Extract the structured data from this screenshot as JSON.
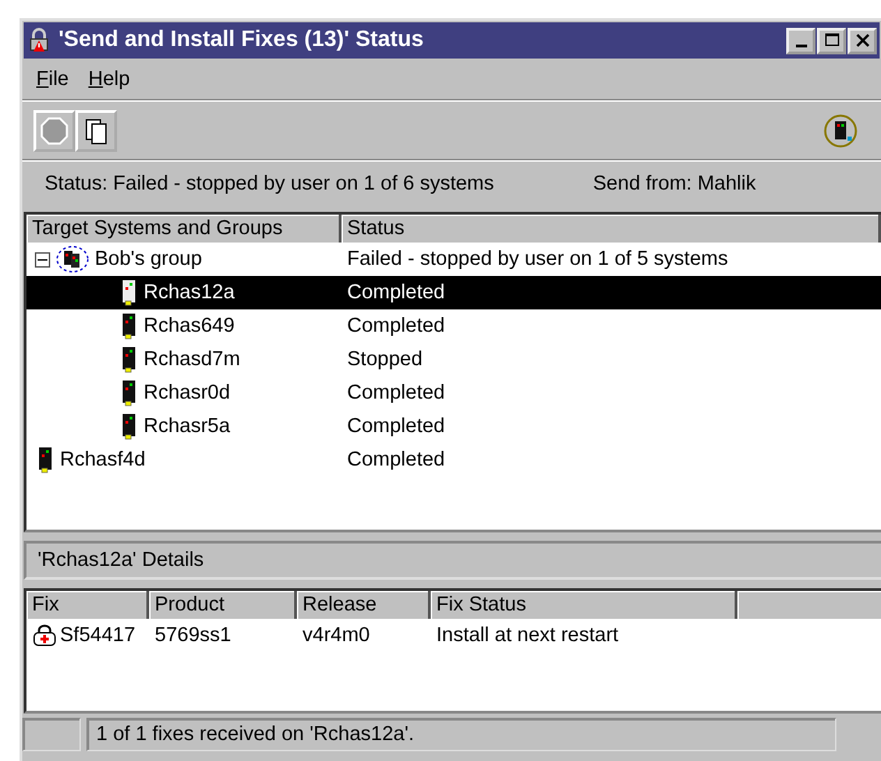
{
  "window": {
    "title": "'Send and Install Fixes (13)' Status"
  },
  "menu": [
    {
      "label": "File"
    },
    {
      "label": "Help"
    }
  ],
  "status_line": {
    "status": "Status: Failed - stopped by user on 1 of 6 systems",
    "send_from": "Send from: Mahlik"
  },
  "tree": {
    "columns": [
      "Target Systems and Groups",
      "Status"
    ],
    "items": [
      {
        "name": "Bob's group",
        "status": "Failed - stopped by user on 1 of 5 systems",
        "kind": "group",
        "expanded": true,
        "selected": false,
        "children": [
          {
            "name": "Rchas12a",
            "status": "Completed",
            "kind": "system",
            "selected": true
          },
          {
            "name": "Rchas649",
            "status": "Completed",
            "kind": "system",
            "selected": false
          },
          {
            "name": "Rchasd7m",
            "status": "Stopped",
            "kind": "system",
            "selected": false
          },
          {
            "name": "Rchasr0d",
            "status": "Completed",
            "kind": "system",
            "selected": false
          },
          {
            "name": "Rchasr5a",
            "status": "Completed",
            "kind": "system",
            "selected": false
          }
        ]
      },
      {
        "name": "Rchasf4d",
        "status": "Completed",
        "kind": "system",
        "selected": false
      }
    ]
  },
  "details": {
    "title": "'Rchas12a' Details",
    "columns": [
      "Fix",
      "Product",
      "Release",
      "Fix Status"
    ],
    "rows": [
      [
        "Sf54417",
        "5769ss1",
        "v4r4m0",
        "Install at next restart"
      ]
    ]
  },
  "status_bar": {
    "text": "1 of 1 fixes received on 'Rchas12a'."
  }
}
